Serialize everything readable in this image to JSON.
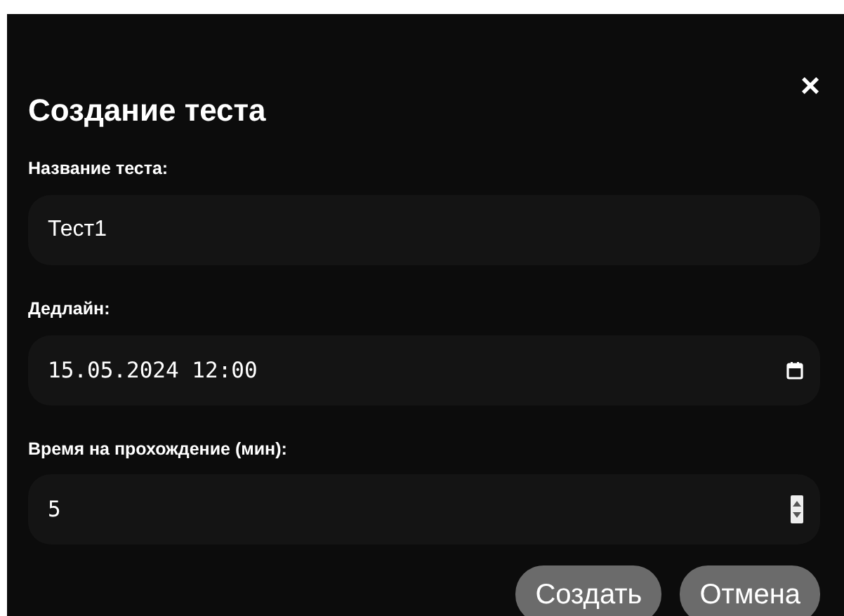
{
  "dialog": {
    "title": "Создание теста",
    "close": "×"
  },
  "fields": [
    {
      "label": "Название теста:",
      "value": "Тест1",
      "kind": "text"
    },
    {
      "label": "Дедлайн:",
      "value": "15.05.2024 12:00",
      "kind": "datetime"
    },
    {
      "label": "Время на прохождение (мин):",
      "value": "5",
      "kind": "number"
    }
  ],
  "buttons": [
    "Создать",
    "Отмена"
  ]
}
